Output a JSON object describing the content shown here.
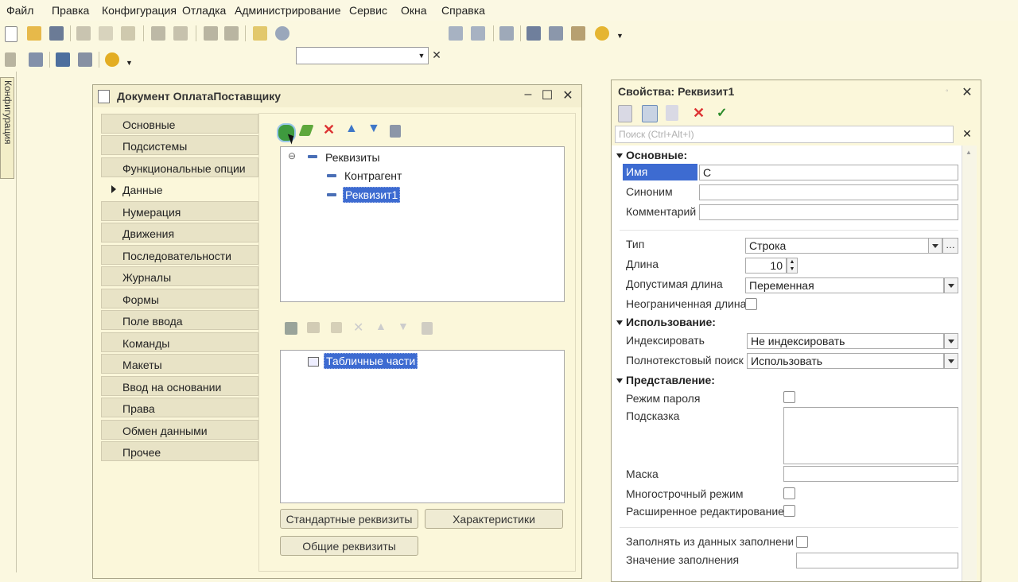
{
  "menu": [
    "Файл",
    "Правка",
    "Конфигурация",
    "Отладка",
    "Администрирование",
    "Сервис",
    "Окна",
    "Справка"
  ],
  "toolbar": {
    "search_value": ""
  },
  "sidebar_tab": {
    "label": "Конфигурация"
  },
  "document_window": {
    "title": "Документ ОплатаПоставщику",
    "nav": [
      {
        "label": "Основные",
        "active": false
      },
      {
        "label": "Подсистемы",
        "active": false
      },
      {
        "label": "Функциональные опции",
        "active": false
      },
      {
        "label": "Данные",
        "active": true
      },
      {
        "label": "Нумерация",
        "active": false
      },
      {
        "label": "Движения",
        "active": false
      },
      {
        "label": "Последовательности",
        "active": false
      },
      {
        "label": "Журналы",
        "active": false
      },
      {
        "label": "Формы",
        "active": false
      },
      {
        "label": "Поле ввода",
        "active": false
      },
      {
        "label": "Команды",
        "active": false
      },
      {
        "label": "Макеты",
        "active": false
      },
      {
        "label": "Ввод на основании",
        "active": false
      },
      {
        "label": "Права",
        "active": false
      },
      {
        "label": "Обмен данными",
        "active": false
      },
      {
        "label": "Прочее",
        "active": false
      }
    ],
    "attributes_tree": {
      "root": "Реквизиты",
      "children": [
        "Контрагент",
        "Реквизит1"
      ],
      "selected": "Реквизит1"
    },
    "tabular_tree": {
      "root": "Табличные части"
    },
    "buttons": {
      "standard": "Стандартные реквизиты",
      "characteristics": "Характеристики",
      "common": "Общие реквизиты"
    }
  },
  "properties_window": {
    "title": "Свойства: Реквизит1",
    "search_placeholder": "Поиск (Ctrl+Alt+I)",
    "sections": {
      "main": "Основные:",
      "usage": "Использование:",
      "presentation": "Представление:"
    },
    "fields": {
      "name_label": "Имя",
      "name_value": "С",
      "synonym_label": "Синоним",
      "synonym_value": "",
      "comment_label": "Комментарий",
      "comment_value": "",
      "type_label": "Тип",
      "type_value": "Строка",
      "length_label": "Длина",
      "length_value": "10",
      "allowed_length_label": "Допустимая длина",
      "allowed_length_value": "Переменная",
      "unlimited_label": "Неограниченная длина",
      "index_label": "Индексировать",
      "index_value": "Не индексировать",
      "fulltext_label": "Полнотекстовый поиск",
      "fulltext_value": "Использовать",
      "password_label": "Режим пароля",
      "tooltip_label": "Подсказка",
      "mask_label": "Маска",
      "multiline_label": "Многострочный режим",
      "extended_label": "Расширенное редактирование",
      "fill_from_label": "Заполнять из данных заполнения",
      "fill_value_label": "Значение заполнения"
    }
  }
}
